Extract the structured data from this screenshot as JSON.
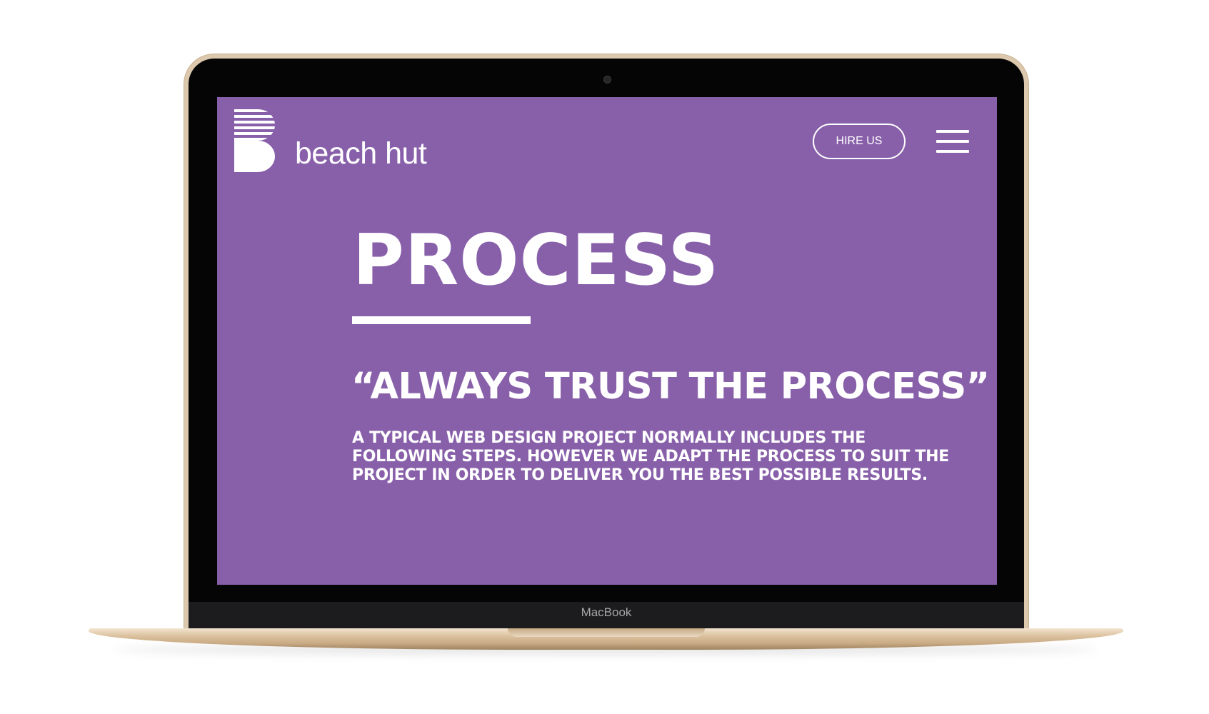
{
  "device": {
    "brand_label": "MacBook"
  },
  "site": {
    "logo_text": "beach hut",
    "hire_label": "HIRE US",
    "menu_icon": "hamburger-icon",
    "accent": "#8860aa"
  },
  "page": {
    "title": "PROCESS",
    "quote": "“ALWAYS TRUST THE PROCESS”",
    "body_lines": [
      "A TYPICAL WEB DESIGN PROJECT NORMALLY INCLUDES THE",
      "FOLLOWING STEPS. HOWEVER WE ADAPT THE PROCESS TO SUIT THE",
      "PROJECT IN ORDER TO DELIVER YOU THE BEST POSSIBLE RESULTS."
    ]
  }
}
